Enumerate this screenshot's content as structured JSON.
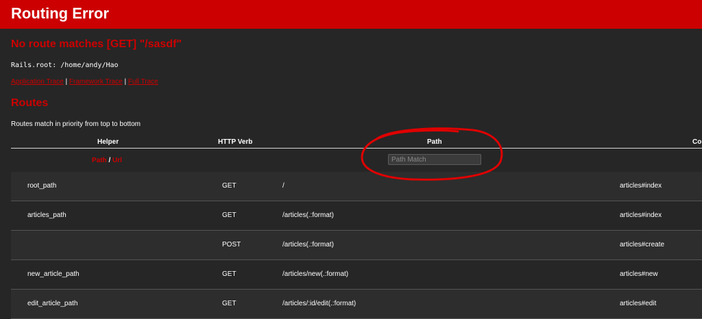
{
  "header": {
    "title": "Routing Error"
  },
  "error": {
    "heading": "No route matches [GET] \"/sasdf\"",
    "rails_root": "Rails.root: /home/andy/Hao"
  },
  "traces": {
    "application": "Application Trace",
    "framework": "Framework Trace",
    "full": "Full Trace",
    "separator": " | "
  },
  "routes": {
    "heading": "Routes",
    "subtitle": "Routes match in priority from top to bottom",
    "columns": {
      "helper": "Helper",
      "verb": "HTTP Verb",
      "path": "Path",
      "controller": "Co"
    },
    "helper_links": {
      "path": "Path",
      "sep": " / ",
      "url": "Url"
    },
    "filter_placeholder": "Path Match",
    "rows": [
      {
        "helper": "root_path",
        "verb": "GET",
        "path": "/",
        "controller": "articles#index"
      },
      {
        "helper": "articles_path",
        "verb": "GET",
        "path": "/articles(.:format)",
        "controller": "articles#index"
      },
      {
        "helper": "",
        "verb": "POST",
        "path": "/articles(.:format)",
        "controller": "articles#create"
      },
      {
        "helper": "new_article_path",
        "verb": "GET",
        "path": "/articles/new(.:format)",
        "controller": "articles#new"
      },
      {
        "helper": "edit_article_path",
        "verb": "GET",
        "path": "/articles/:id/edit(.:format)",
        "controller": "articles#edit"
      }
    ]
  },
  "annotation": {
    "color": "#e00000",
    "shape": "hand-drawn-ellipse"
  }
}
